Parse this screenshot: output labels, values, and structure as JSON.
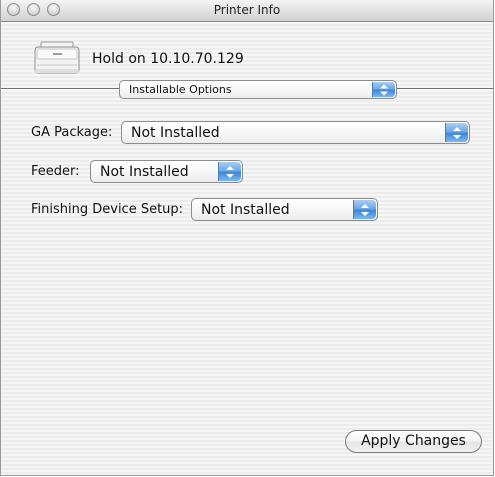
{
  "window": {
    "title": "Printer Info",
    "controls": [
      "close-button",
      "minimize-button",
      "zoom-button"
    ]
  },
  "header": {
    "printer_icon": "printer-icon",
    "printer_name": "Hold on 10.10.70.129",
    "section_popup": "Installable Options"
  },
  "options": [
    {
      "label": "GA Package:",
      "value": "Not Installed"
    },
    {
      "label": "Feeder:",
      "value": "Not Installed"
    },
    {
      "label": "Finishing Device Setup:",
      "value": "Not Installed"
    }
  ],
  "footer": {
    "apply_label": "Apply Changes"
  },
  "colors": {
    "popup_arrow_blue": "#3f86d6",
    "window_background": "#ececec"
  }
}
